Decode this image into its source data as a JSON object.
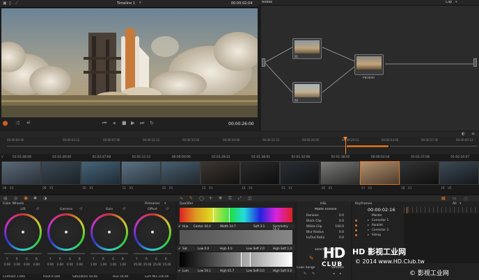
{
  "viewer": {
    "timeline_name": "Timeline 1",
    "top_timecode": "00:00:02:04",
    "timecode": "00:00:26:00"
  },
  "nodes": {
    "title": "Nodes",
    "mode": "Clip",
    "n1_label": "01",
    "n2_label": "02",
    "parallel_label": "Parallel"
  },
  "timeline": {
    "ruler": [
      "00:00:00:00",
      "00:00:03:12",
      "00:00:07:00",
      "00:00:11:12",
      "00:00:15:00",
      "00:00:19:00",
      "00:00:22:12",
      "00:00:26:00",
      "00:00:29:12",
      "00:00:33:00",
      "00:00:37:00",
      "00:00:40:12"
    ]
  },
  "clips": [
    {
      "tc": "01:01:48:08",
      "num": "08",
      "track": "V1",
      "c1": "#5a6a78",
      "c2": "#2a3038"
    },
    {
      "tc": "01:01:46:04",
      "num": "09",
      "track": "V1",
      "c1": "#3b4a55",
      "c2": "#1b2126"
    },
    {
      "tc": "01:02:47:00",
      "num": "10",
      "track": "V1",
      "c1": "#46657a",
      "c2": "#1e2b34"
    },
    {
      "tc": "01:01:11:11",
      "num": "11",
      "track": "V1",
      "c1": "#5b7282",
      "c2": "#2a3540"
    },
    {
      "tc": "00:00:00:00",
      "num": "12",
      "track": "V1",
      "c1": "#486070",
      "c2": "#20262c"
    },
    {
      "tc": "01:01:29:21",
      "num": "13",
      "track": "V1",
      "c1": "#3c3630",
      "c2": "#141210"
    },
    {
      "tc": "01:01:38:01",
      "num": "14",
      "track": "V1",
      "c1": "#2b2b2b",
      "c2": "#0e0e0e"
    },
    {
      "tc": "01:01:32:06",
      "num": "15",
      "track": "V1",
      "c1": "#2a2e33",
      "c2": "#111315"
    },
    {
      "tc": "01:01:38:02",
      "num": "16",
      "track": "V1",
      "c1": "#7a7a78",
      "c2": "#2a2a2a"
    },
    {
      "tc": "00:00:02:04",
      "num": "17",
      "track": "V1",
      "c1": "#b39270",
      "c2": "#4a3a2a"
    },
    {
      "tc": "01:01:37:08",
      "num": "18",
      "track": "V1",
      "c1": "#333333",
      "c2": "#0f0f0f"
    },
    {
      "tc": "01:02:16:07",
      "num": "19",
      "track": "V1",
      "c1": "#3d4a55",
      "c2": "#14181c"
    }
  ],
  "wheels": {
    "title": "Color Wheels",
    "mode": "Primaries",
    "labels": [
      "Lift",
      "Gamma",
      "Gain",
      "Offset"
    ],
    "values": [
      [
        "0.00",
        "0.00",
        "0.00",
        "0.00"
      ],
      [
        "0.00",
        "0.00",
        "0.00",
        "0.00"
      ],
      [
        "1.00",
        "1.00",
        "1.00",
        "1.00"
      ],
      [
        "25.00",
        "25.00",
        "25.00",
        "25.00"
      ]
    ],
    "channel_letters": [
      "Y",
      "R",
      "G",
      "B"
    ],
    "contrast": "Contrast 1.000",
    "pivot": "Pivot 0.500",
    "saturation": "Saturation 50.00",
    "hue": "Hue 50.00",
    "lum_mix": "Lum Mix 100.00"
  },
  "qualifier": {
    "title": "Qualifier",
    "hue": {
      "label": "Hue",
      "center": "Center 44.4",
      "width": "Width 14.7",
      "soft": "Soft 3.1",
      "sym": "Symmetry 50.0"
    },
    "sat": {
      "label": "Sat",
      "low": "Low 0.0",
      "high": "High 4.0",
      "lowsoft": "Low Soft 2.0",
      "highsoft": "High Soft 1.0"
    },
    "lum": {
      "label": "Lum",
      "low": "Low 54.1",
      "high": "High 61.7",
      "lowsoft": "Low Soft 0.0",
      "highsoft": "High Soft 0.0"
    }
  },
  "hsl": {
    "title": "HSL",
    "subtitle": "Matte Finesse",
    "rows": [
      {
        "label": "Denoise",
        "value": "0.0"
      },
      {
        "label": "Black Clip",
        "value": "0.0"
      },
      {
        "label": "White Clip",
        "value": "100.0"
      },
      {
        "label": "Blur Radius",
        "value": "0.0"
      },
      {
        "label": "In/Out Ratio",
        "value": "0.0"
      }
    ],
    "selection_range": "Selection Range",
    "color_range": "Color Range",
    "softness": "Softness"
  },
  "keyframes": {
    "title": "Keyframes",
    "all": "All",
    "timecode": "00:00:02:16",
    "items": [
      "Master",
      "Corrector 1",
      "Parallel",
      "Corrector 2",
      "Sizing"
    ]
  },
  "watermark": {
    "logo_hd": "HD",
    "logo_club": "CLUB",
    "cn1": "HD 影视工业网",
    "copyright": "© 2014 www.HD.Club.tw",
    "cn2": "© 影视工业网"
  }
}
